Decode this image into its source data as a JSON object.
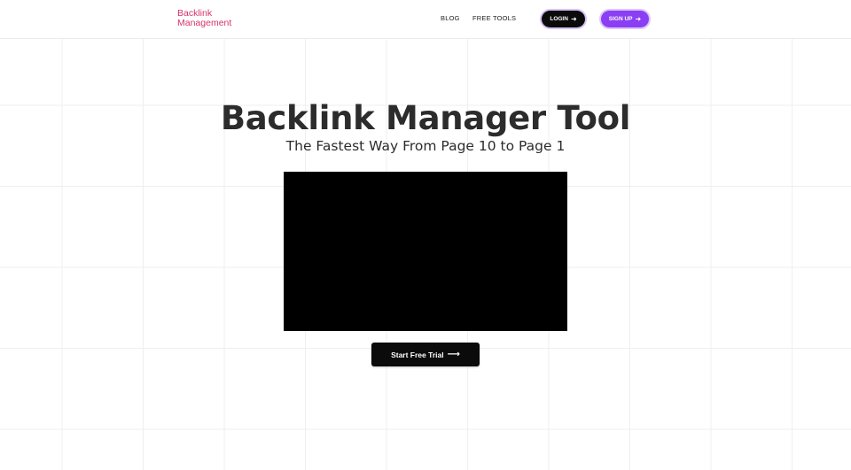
{
  "nav": {
    "logo_line1": "Backlink",
    "logo_line2": "Management",
    "links": [
      {
        "label": "BLOG"
      },
      {
        "label": "FREE TOOLS"
      }
    ],
    "login_label": "LOGIN",
    "signup_label": "SIGN UP",
    "arrow_icon": "arrow-right-icon"
  },
  "hero": {
    "title": "Backlink Manager Tool",
    "subtitle": "The Fastest Way From Page 10 to Page 1",
    "cta_label": "Start Free Trial"
  },
  "colors": {
    "brand": "#d6336c",
    "signup": "#8a3ff2",
    "dark": "#0b0b0b"
  }
}
